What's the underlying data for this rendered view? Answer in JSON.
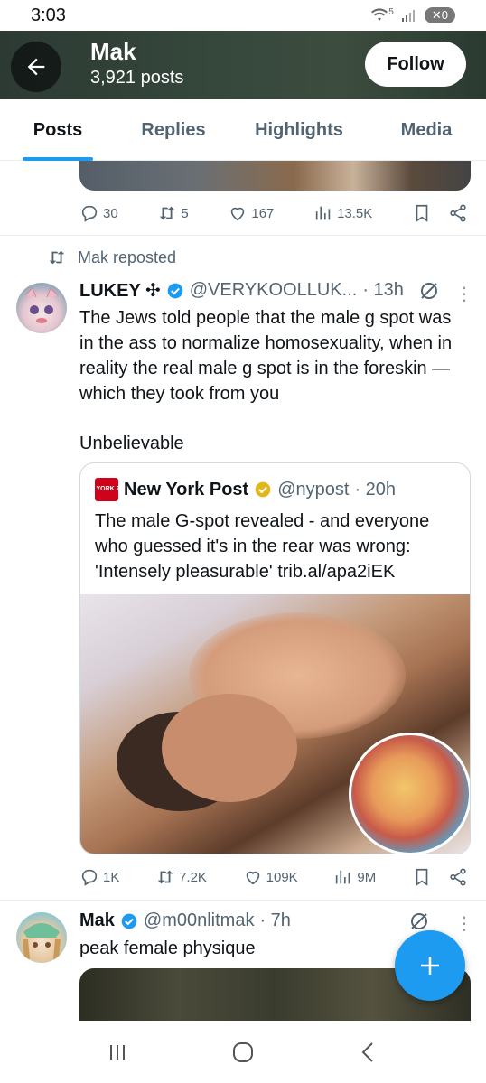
{
  "status_bar": {
    "time": "3:03",
    "signal_label": "5",
    "badge": "0"
  },
  "header": {
    "name": "Mak",
    "post_count": "3,921 posts",
    "follow_label": "Follow"
  },
  "tabs": [
    {
      "label": "Posts"
    },
    {
      "label": "Replies"
    },
    {
      "label": "Highlights"
    },
    {
      "label": "Media"
    }
  ],
  "prev_post": {
    "actions": {
      "replies": "30",
      "reposts": "5",
      "likes": "167",
      "views": "13.5K"
    }
  },
  "repost": {
    "label": "Mak reposted",
    "author": {
      "name": "LUKEY ✣",
      "handle": "@VERYKOOLLUK...",
      "time": "· 13h"
    },
    "text": "The Jews told people that the male g spot was in the ass to normalize homosexuality, when in reality the real male g spot is in the foreskin — which they took from you",
    "text2": "Unbelievable",
    "quote": {
      "logo_text": "NEW YORK POST",
      "name": "New York Post",
      "handle": "@nypost",
      "time": "· 20h",
      "text": "The male G-spot revealed - and everyone who guessed it's in the rear was wrong: 'Intensely pleasurable' trib.al/apa2iEK"
    },
    "actions": {
      "replies": "1K",
      "reposts": "7.2K",
      "likes": "109K",
      "views": "9M"
    }
  },
  "next_post": {
    "author": {
      "name": "Mak",
      "handle": "@m00nlitmak",
      "time": "· 7h"
    },
    "text": "peak female physique"
  },
  "colors": {
    "accent": "#1d9bf0",
    "verified_gold": "#e2b719",
    "muted": "#536471"
  }
}
